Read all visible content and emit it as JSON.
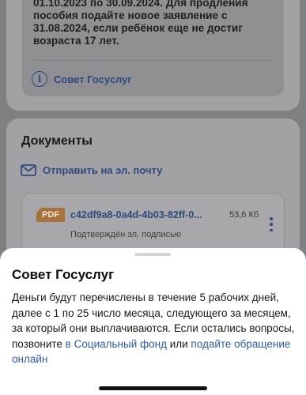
{
  "notice": {
    "text": "01.10.2023 по 30.09.2024. Для продления\nпособия подайте новое заявление с\n31.08.2024, если ребёнок еще не достиг\nвозраста 17 лет.",
    "link_label": "Совет Госуслуг"
  },
  "documents": {
    "title": "Документы",
    "send_link": "Отправить на эл. почту",
    "file": {
      "badge": "PDF",
      "name": "c42df9a8-0a4d-4b03-82ff-0...",
      "size": "53,6 Кб",
      "status": "Подтверждён эл. подписью"
    }
  },
  "sheet": {
    "title": "Совет Госуслуг",
    "body_text": "Деньги будут перечислены в течение 5 рабочих дней, далее с 1 по 25 число месяца, следующего за месяцем, за который они выплачиваются. Если остались вопросы, позвоните ",
    "link_fund": "в Социальный фонд",
    "connector": " или ",
    "link_online": "подайте обращение онлайн"
  },
  "colors": {
    "link": "#2c5ba6",
    "pdf_badge": "#a6713a",
    "overlay": "#7f7f84"
  },
  "icons": [
    "info-icon",
    "mail-icon",
    "more-vertical-icon",
    "pdf-icon"
  ]
}
